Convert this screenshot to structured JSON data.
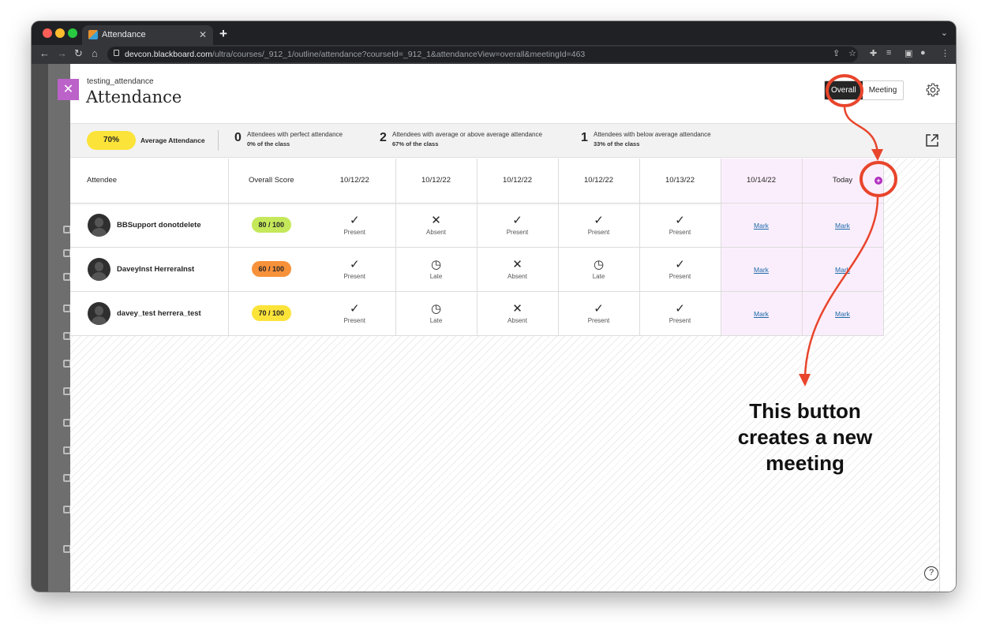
{
  "browser": {
    "tab_title": "Attendance",
    "tab_close": "✕",
    "new_tab": "+",
    "url_host": "devcon.blackboard.com",
    "url_path": "/ultra/courses/_912_1/outline/attendance?courseId=_912_1&attendanceView=overall&meetingId=463"
  },
  "header": {
    "breadcrumb": "testing_attendance",
    "title": "Attendance",
    "close_glyph": "✕",
    "view_toggle": {
      "overall": "Overall",
      "meeting": "Meeting",
      "selected": "Overall"
    }
  },
  "summary": {
    "average_value": "70%",
    "average_label": "Average Attendance",
    "perfect": {
      "count": "0",
      "label": "Attendees with perfect attendance",
      "sub": "0% of the class"
    },
    "above": {
      "count": "2",
      "label": "Attendees with average or above average attendance",
      "sub": "67% of the class"
    },
    "below": {
      "count": "1",
      "label": "Attendees with below average attendance",
      "sub": "33% of the class"
    }
  },
  "table": {
    "headers": {
      "attendee": "Attendee",
      "score": "Overall Score",
      "dates": [
        "10/12/22",
        "10/12/22",
        "10/12/22",
        "10/12/22",
        "10/13/22",
        "10/14/22",
        "Today"
      ]
    },
    "add_meeting_glyph": "+",
    "rows": [
      {
        "name": "BBSupport donotdelete",
        "score": "80 / 100",
        "score_color": "#c4e85a",
        "statuses": [
          {
            "glyph": "✓",
            "label": "Present",
            "icon": "check-icon"
          },
          {
            "glyph": "✕",
            "label": "Absent",
            "icon": "x-icon"
          },
          {
            "glyph": "✓",
            "label": "Present",
            "icon": "check-icon"
          },
          {
            "glyph": "✓",
            "label": "Present",
            "icon": "check-icon"
          },
          {
            "glyph": "✓",
            "label": "Present",
            "icon": "check-icon"
          }
        ],
        "marks": [
          "Mark",
          "Mark"
        ]
      },
      {
        "name": "DaveyInst HerreraInst",
        "score": "60 / 100",
        "score_color": "#f7913a",
        "statuses": [
          {
            "glyph": "✓",
            "label": "Present",
            "icon": "check-icon"
          },
          {
            "glyph": "◷",
            "label": "Late",
            "icon": "clock-icon"
          },
          {
            "glyph": "✕",
            "label": "Absent",
            "icon": "x-icon"
          },
          {
            "glyph": "◷",
            "label": "Late",
            "icon": "clock-icon"
          },
          {
            "glyph": "✓",
            "label": "Present",
            "icon": "check-icon"
          }
        ],
        "marks": [
          "Mark",
          "Mark"
        ]
      },
      {
        "name": "davey_test herrera_test",
        "score": "70 / 100",
        "score_color": "#fbe339",
        "statuses": [
          {
            "glyph": "✓",
            "label": "Present",
            "icon": "check-icon"
          },
          {
            "glyph": "◷",
            "label": "Late",
            "icon": "clock-icon"
          },
          {
            "glyph": "✕",
            "label": "Absent",
            "icon": "x-icon"
          },
          {
            "glyph": "✓",
            "label": "Present",
            "icon": "check-icon"
          },
          {
            "glyph": "✓",
            "label": "Present",
            "icon": "check-icon"
          }
        ],
        "marks": [
          "Mark",
          "Mark"
        ]
      }
    ]
  },
  "help_glyph": "?",
  "annotation": {
    "text_line1": "This button",
    "text_line2": "creates a new",
    "text_line3": "meeting",
    "color": "#e8452c"
  }
}
